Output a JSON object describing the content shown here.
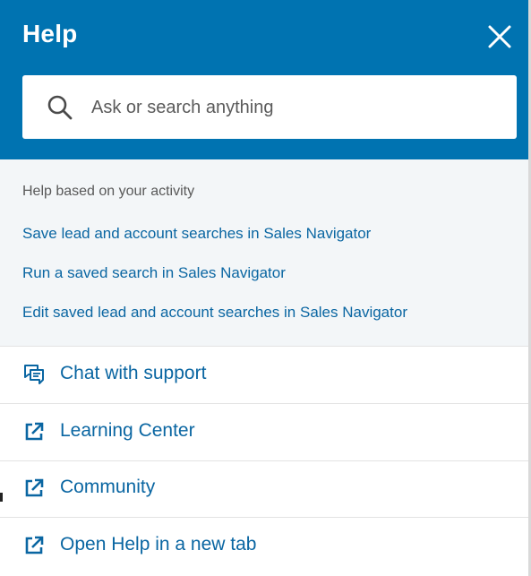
{
  "header": {
    "title": "Help",
    "close_icon": "close-icon",
    "background_color": "#0073b1"
  },
  "search": {
    "placeholder": "Ask or search anything",
    "value": "",
    "icon": "search-icon"
  },
  "activity": {
    "heading": "Help based on your activity",
    "links": [
      "Save lead and account searches in Sales Navigator",
      "Run a saved search in Sales Navigator",
      "Edit saved lead and account searches in Sales Navigator"
    ]
  },
  "menu": [
    {
      "label": "Chat with support",
      "icon": "chat-icon"
    },
    {
      "label": "Learning Center",
      "icon": "external-link-icon"
    },
    {
      "label": "Community",
      "icon": "external-link-icon"
    },
    {
      "label": "Open Help in a new tab",
      "icon": "external-link-icon"
    }
  ],
  "colors": {
    "accent": "#0073b1",
    "link": "#0a66a2",
    "activity_bg": "#f3f6f8"
  }
}
